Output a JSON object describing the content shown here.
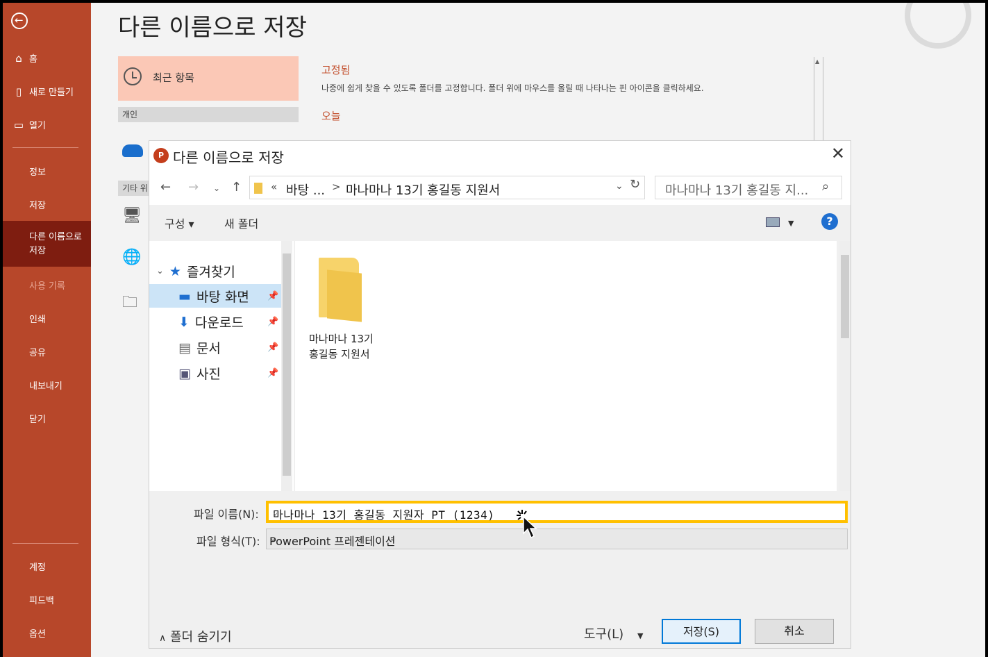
{
  "sidebar": {
    "items": [
      {
        "label": "홈",
        "icon": "home-icon"
      },
      {
        "label": "새로 만들기",
        "icon": "new-document-icon"
      },
      {
        "label": "열기",
        "icon": "open-folder-icon"
      },
      {
        "label": "정보"
      },
      {
        "label": "저장"
      },
      {
        "label": "다른 이름으로\n저장"
      },
      {
        "label": "사용 기록"
      },
      {
        "label": "인쇄"
      },
      {
        "label": "공유"
      },
      {
        "label": "내보내기"
      },
      {
        "label": "닫기"
      },
      {
        "label": "계정"
      },
      {
        "label": "피드백"
      },
      {
        "label": "옵션"
      }
    ]
  },
  "backstage": {
    "title": "다른 이름으로 저장",
    "recent": "최근 항목",
    "group_personal": "개인",
    "group_other": "기타 위",
    "pinned_heading": "고정됨",
    "pinned_desc": "나중에 쉽게 찾을 수 있도록 폴더를 고정합니다. 폴더 위에 마우스를 올릴 때 나타나는 핀 아이콘을 클릭하세요.",
    "today_heading": "오늘"
  },
  "dialog": {
    "app_icon": "P",
    "title": "다른 이름으로 저장",
    "address": {
      "prefix": "«",
      "crumb1": "바탕 ...",
      "sep": ">",
      "crumb2": "마나마나 13기 홍길동 지원서"
    },
    "search_placeholder": "마나마나 13기 홍길동 지...",
    "toolbar": {
      "organize": "구성 ▾",
      "new_folder": "새 폴더"
    },
    "nav": {
      "favorites": "즐겨찾기",
      "items": [
        {
          "label": "바탕 화면",
          "icon": "desktop-icon"
        },
        {
          "label": "다운로드",
          "icon": "download-icon"
        },
        {
          "label": "문서",
          "icon": "document-icon"
        },
        {
          "label": "사진",
          "icon": "picture-icon"
        }
      ]
    },
    "folder_item": "마나마나 13기 홍길동 지원서",
    "filename_label": "파일 이름(N):",
    "filename_value": "마나마나 13기 홍길동 지원자 PT (1234)",
    "filetype_label": "파일 형식(T):",
    "filetype_value": "PowerPoint 프레젠테이션",
    "hide_folders": "폴더 숨기기",
    "tools": "도구(L)",
    "save": "저장(S)",
    "cancel": "취소"
  }
}
